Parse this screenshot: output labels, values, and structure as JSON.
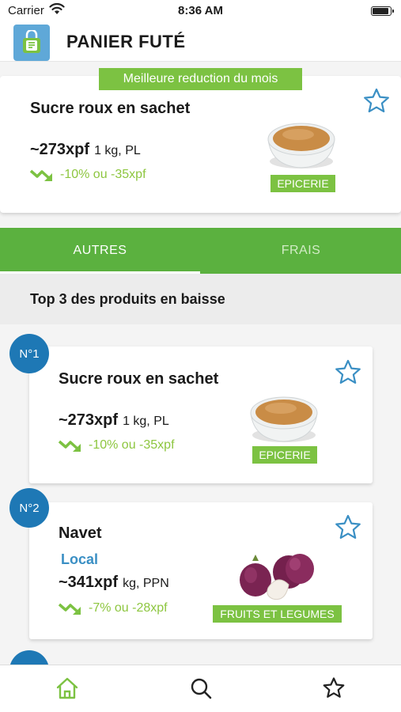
{
  "status_bar": {
    "carrier": "Carrier",
    "time": "8:36 AM",
    "battery_level": 0.9
  },
  "header": {
    "title": "PANIER FUTÉ",
    "logo_icon": "basket-icon"
  },
  "featured": {
    "banner": "Meilleure reduction du mois",
    "product": {
      "name": "Sucre roux en sachet",
      "price": "~273xpf",
      "unit": "1 kg, PL",
      "trend": "-10% ou -35xpf",
      "category": "EPICERIE",
      "image": "brown-sugar-bowl"
    }
  },
  "tabs": [
    {
      "label": "AUTRES",
      "active": true
    },
    {
      "label": "FRAIS",
      "active": false
    }
  ],
  "section": {
    "title": "Top 3 des produits en baisse"
  },
  "ranked": [
    {
      "rank": "N°1",
      "name": "Sucre roux en sachet",
      "origin": "",
      "price": "~273xpf",
      "unit": "1 kg, PL",
      "trend": "-10% ou -35xpf",
      "category": "EPICERIE",
      "image": "brown-sugar-bowl"
    },
    {
      "rank": "N°2",
      "name": "Navet",
      "origin": "Local",
      "price": "~341xpf",
      "unit": "kg, PPN",
      "trend": "-7% ou -28xpf",
      "category": "FRUITS ET LEGUMES",
      "image": "turnips"
    }
  ],
  "bottom_nav": [
    {
      "name": "home",
      "icon": "home-icon",
      "active": true
    },
    {
      "name": "search",
      "icon": "search-icon",
      "active": false
    },
    {
      "name": "favorites",
      "icon": "star-icon",
      "active": false
    }
  ],
  "colors": {
    "brand_green": "#5bb13f",
    "light_green": "#7cc242",
    "trend_green": "#8dc63f",
    "blue": "#1e78b5",
    "star_blue": "#3a8fc4"
  }
}
